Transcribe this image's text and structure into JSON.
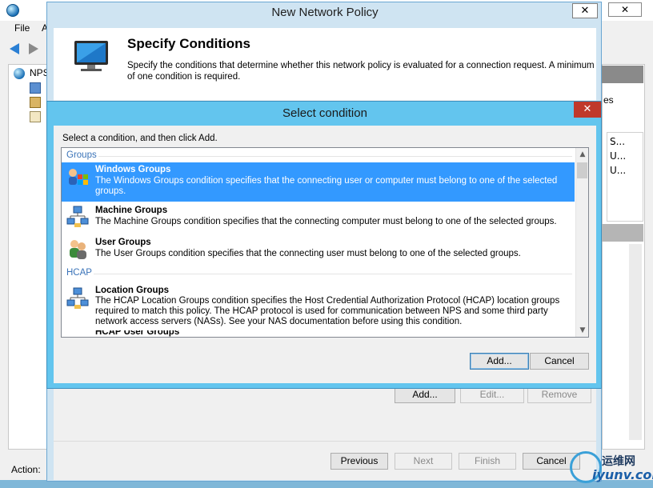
{
  "mmc": {
    "menu": [
      "File",
      "A"
    ],
    "tree_item": "NPS",
    "status_label": "Action:",
    "right_list": [
      "S...",
      "U...",
      "U..."
    ],
    "right_fragment": "es"
  },
  "new_policy": {
    "title": "New Network Policy",
    "heading": "Specify Conditions",
    "description": "Specify the conditions that determine whether this network policy is evaluated for a connection request. A minimum of one condition is required.",
    "buttons": {
      "add": "Add...",
      "edit": "Edit...",
      "remove": "Remove"
    },
    "footer": {
      "previous": "Previous",
      "next": "Next",
      "finish": "Finish",
      "cancel": "Cancel"
    }
  },
  "select_condition": {
    "title": "Select condition",
    "instruction": "Select a condition, and then click Add.",
    "groups": [
      {
        "label": "Groups",
        "items": [
          {
            "title": "Windows Groups",
            "description": "The Windows Groups condition specifies that the connecting user or computer must belong to one of the selected groups.",
            "icon": "windows-groups-icon",
            "selected": true
          },
          {
            "title": "Machine Groups",
            "description": "The Machine Groups condition specifies that the connecting computer must belong to one of the selected groups.",
            "icon": "machine-groups-icon",
            "selected": false
          },
          {
            "title": "User Groups",
            "description": "The User Groups condition specifies that the connecting user must belong to one of the selected groups.",
            "icon": "user-groups-icon",
            "selected": false
          }
        ]
      },
      {
        "label": "HCAP",
        "items": [
          {
            "title": "Location Groups",
            "description": "The HCAP Location Groups condition specifies the Host Credential Authorization Protocol (HCAP) location groups required to match this policy. The HCAP protocol is used for communication between NPS and some third party network access servers (NASs). See your NAS documentation before using this condition.",
            "icon": "location-groups-icon",
            "selected": false
          }
        ]
      }
    ],
    "partial_item": "HCAP User Groups",
    "buttons": {
      "add": "Add...",
      "cancel": "Cancel"
    }
  },
  "watermark": {
    "cn": "运维网",
    "en": "iyunv.com"
  },
  "colors": {
    "selection": "#3399ff",
    "dialog_frame": "#63c5ee",
    "group_label": "#3a73b8",
    "close_red": "#c0392b"
  }
}
